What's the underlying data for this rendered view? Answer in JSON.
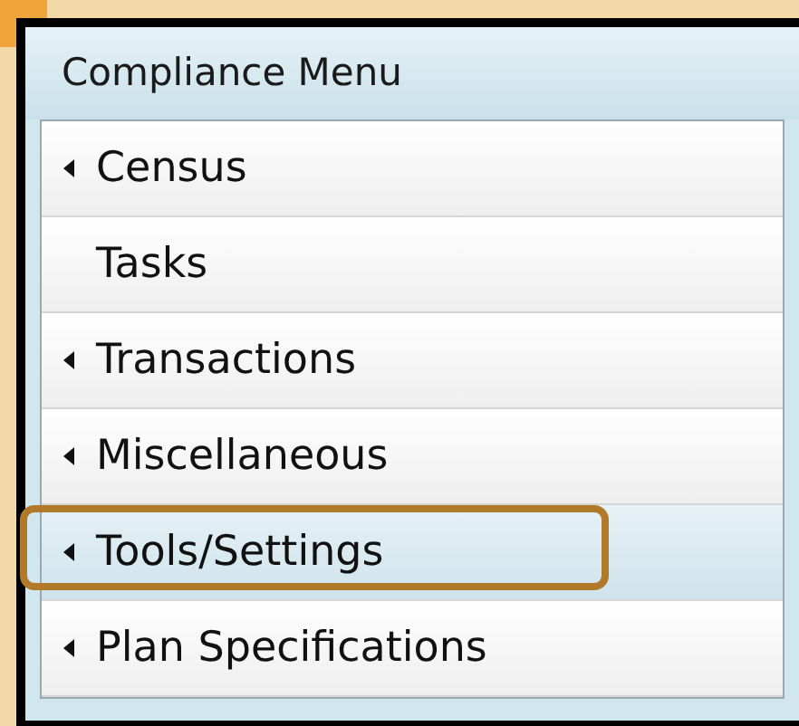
{
  "menu": {
    "title": "Compliance Menu",
    "items": [
      {
        "label": "Census",
        "has_submenu": true,
        "selected": false,
        "outlined": false
      },
      {
        "label": "Tasks",
        "has_submenu": false,
        "selected": false,
        "outlined": false
      },
      {
        "label": "Transactions",
        "has_submenu": true,
        "selected": false,
        "outlined": false
      },
      {
        "label": "Miscellaneous",
        "has_submenu": true,
        "selected": false,
        "outlined": false
      },
      {
        "label": "Tools/Settings",
        "has_submenu": true,
        "selected": true,
        "outlined": true
      },
      {
        "label": "Plan Specifications",
        "has_submenu": true,
        "selected": false,
        "outlined": false
      }
    ]
  }
}
